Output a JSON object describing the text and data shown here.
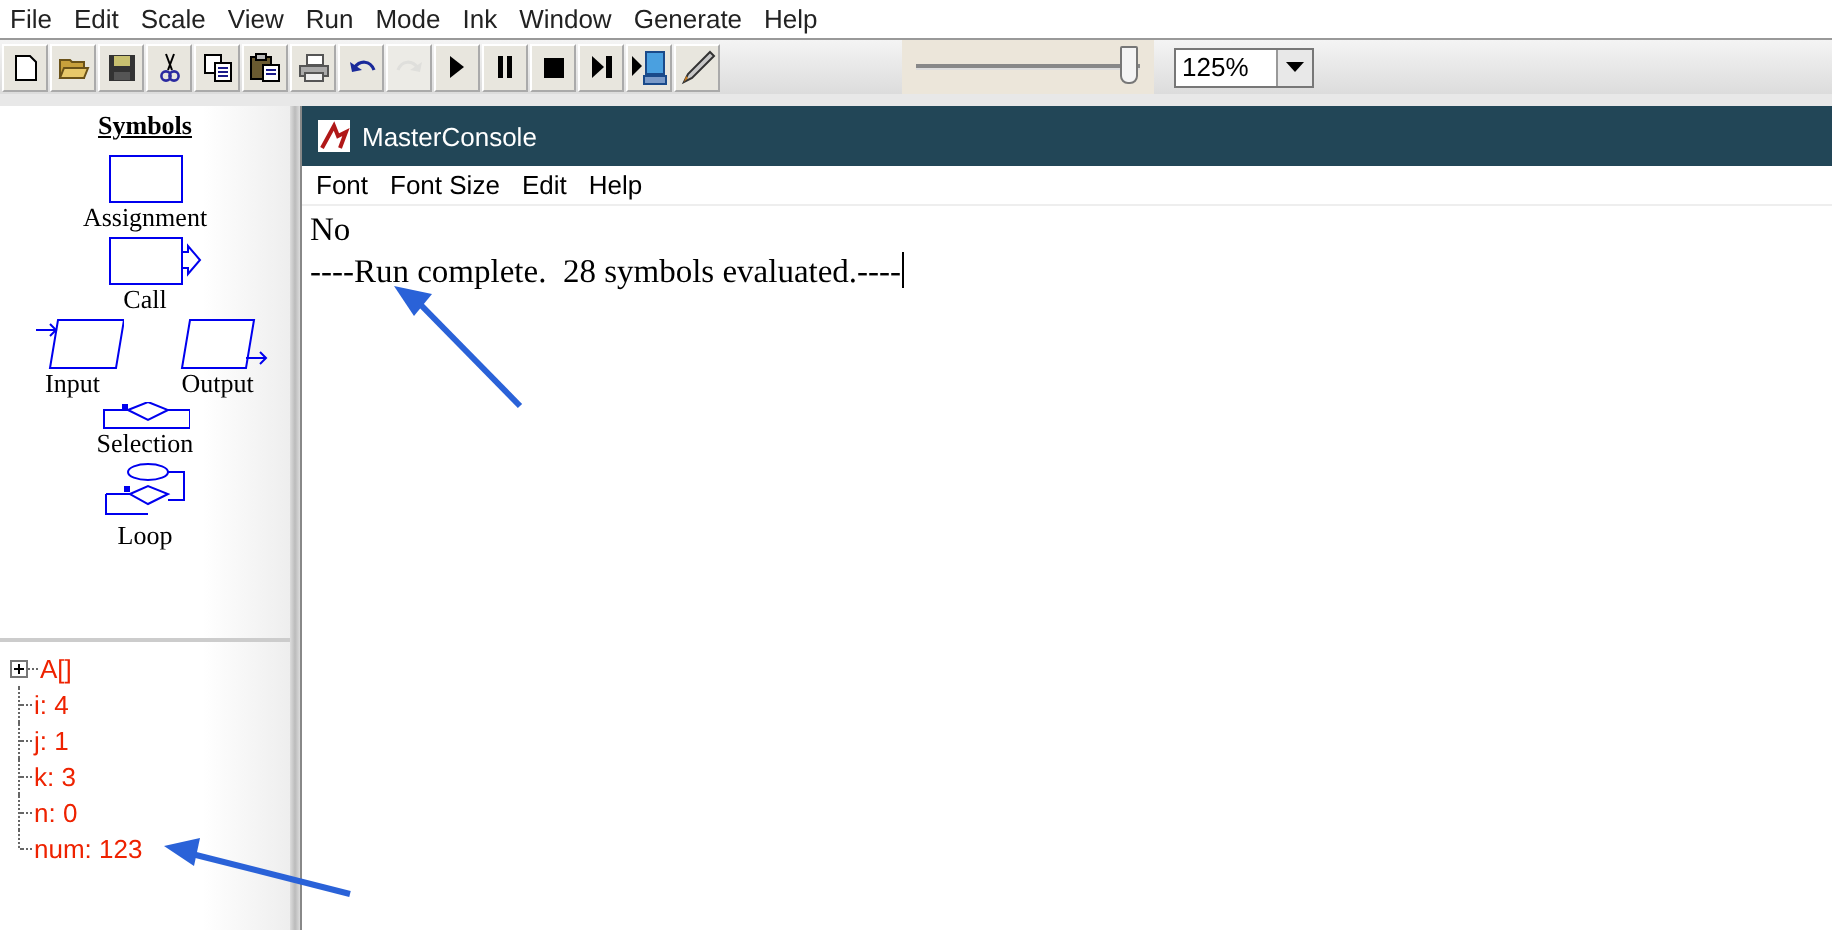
{
  "menu_bar": [
    {
      "label": "File"
    },
    {
      "label": "Edit"
    },
    {
      "label": "Scale"
    },
    {
      "label": "View"
    },
    {
      "label": "Run"
    },
    {
      "label": "Mode"
    },
    {
      "label": "Ink"
    },
    {
      "label": "Window"
    },
    {
      "label": "Generate"
    },
    {
      "label": "Help"
    }
  ],
  "toolbar": [
    {
      "disabled": false
    },
    {
      "disabled": false
    },
    {
      "disabled": false
    },
    {
      "disabled": false
    },
    {
      "disabled": false
    },
    {
      "disabled": false
    },
    {
      "disabled": false
    },
    {
      "disabled": false
    },
    {
      "disabled": true
    },
    {
      "disabled": false
    },
    {
      "disabled": false
    },
    {
      "disabled": false
    },
    {
      "disabled": false
    },
    {
      "disabled": false
    },
    {
      "disabled": false
    }
  ],
  "speed_slider": {
    "level": 1
  },
  "zoom_combo": {
    "value": "125%"
  },
  "symbols": {
    "title": "Symbols",
    "items": [
      {
        "kind": "assignment",
        "label": "Assignment"
      },
      {
        "kind": "call",
        "label": "Call"
      },
      {
        "kind": "input",
        "label": "Input"
      },
      {
        "kind": "output",
        "label": "Output"
      },
      {
        "kind": "selection",
        "label": "Selection"
      },
      {
        "kind": "loop",
        "label": "Loop"
      }
    ]
  },
  "variables": [
    {
      "kind": "array",
      "label": "A[]",
      "expanded": false
    },
    {
      "kind": "value",
      "label": "i: 4"
    },
    {
      "kind": "value",
      "label": "j: 1"
    },
    {
      "kind": "value",
      "label": "k: 3"
    },
    {
      "kind": "value",
      "label": "n: 0"
    },
    {
      "kind": "value",
      "label": "num: 123"
    }
  ],
  "console": {
    "title": "MasterConsole",
    "menu": [
      {
        "label": "Font"
      },
      {
        "label": "Font Size"
      },
      {
        "label": "Edit"
      },
      {
        "label": "Help"
      }
    ],
    "lines": [
      "No",
      "----Run complete.  28 symbols evaluated.----"
    ]
  }
}
